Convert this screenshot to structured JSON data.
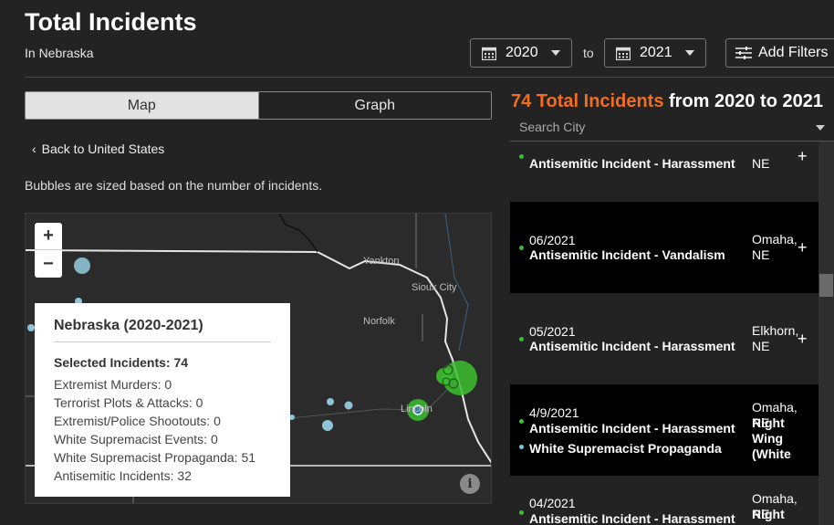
{
  "header": {
    "title": "Total Incidents",
    "subtitle": "In Nebraska",
    "from_year": "2020",
    "to_label": "to",
    "to_year": "2021",
    "filters_label": "Add Filters"
  },
  "tabs": [
    {
      "label": "Map",
      "active": true
    },
    {
      "label": "Graph",
      "active": false
    }
  ],
  "back_link": "Back to United States",
  "map_note": "Bubbles are sized based on the number of incidents.",
  "map": {
    "zoom_in": "+",
    "zoom_out": "−",
    "info": "i",
    "labels": {
      "yankton": "Yankton",
      "sioux_city": "Sioux City",
      "norfolk": "Norfolk",
      "lincoln": "Lincoln"
    }
  },
  "tooltip": {
    "title": "Nebraska (2020-2021)",
    "selected": "Selected Incidents: 74",
    "rows": [
      "Extremist Murders: 0",
      "Terrorist Plots & Attacks: 0",
      "Extremist/Police Shootouts: 0",
      "White Supremacist Events: 0",
      "White Supremacist Propaganda: 51",
      "Antisemitic Incidents: 32"
    ]
  },
  "summary": {
    "count_text": "74 Total Incidents",
    "range_text": " from 2020 to 2021"
  },
  "search": {
    "placeholder": "Search City"
  },
  "incidents": [
    {
      "date": "",
      "types": [
        "Antisemitic Incident - Harassment"
      ],
      "location": "NE",
      "category": ""
    },
    {
      "date": "06/2021",
      "types": [
        "Antisemitic Incident - Vandalism"
      ],
      "location": "Omaha, NE",
      "category": ""
    },
    {
      "date": "05/2021",
      "types": [
        "Antisemitic Incident - Harassment"
      ],
      "location": "Elkhorn, NE",
      "category": ""
    },
    {
      "date": "4/9/2021",
      "types": [
        "Antisemitic Incident - Harassment",
        "White Supremacist Propaganda"
      ],
      "location": "Omaha, NE",
      "category": "Right Wing (White Supremacist"
    },
    {
      "date": "04/2021",
      "types": [
        "Antisemitic Incident - Harassment"
      ],
      "location": "Omaha, NE",
      "category": "Right Wing (White"
    }
  ],
  "colors": {
    "accent": "#f26d21",
    "antisemitic_dot": "#37c22a",
    "propaganda_dot": "#7bc7e0"
  }
}
